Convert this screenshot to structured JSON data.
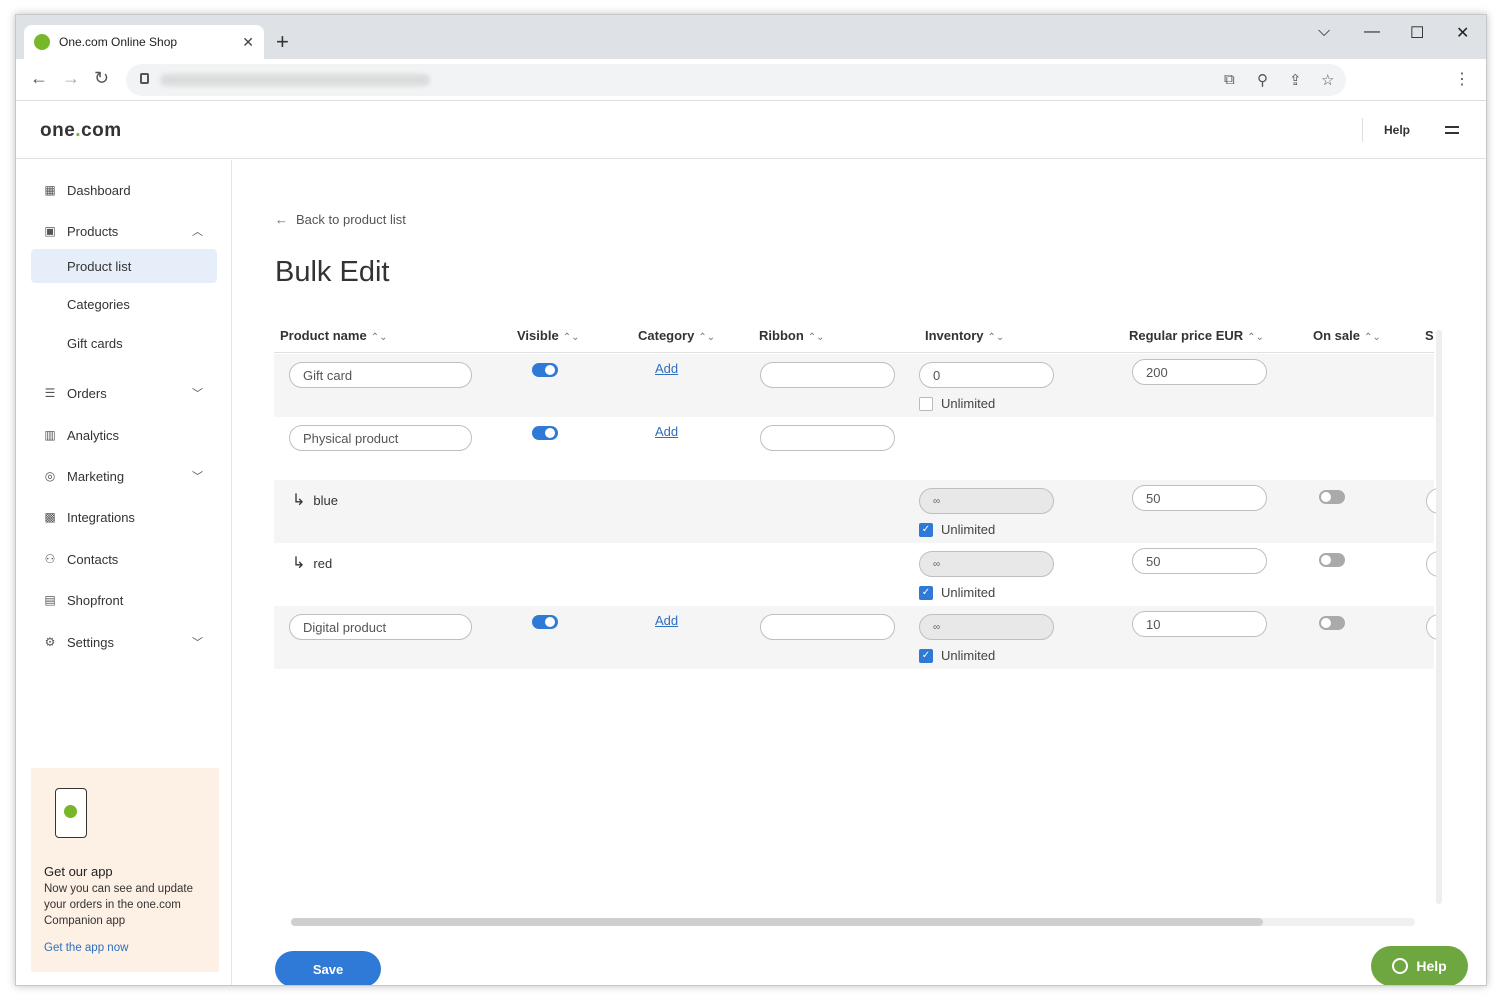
{
  "browser": {
    "tab_title": "One.com Online Shop",
    "close_glyph": "✕",
    "new_tab_glyph": "+",
    "minimize_glyph": "⌵",
    "maximize_glyph": "☐",
    "restore_glyph": "—",
    "window_close_glyph": "✕",
    "back_glyph": "←",
    "forward_glyph": "→",
    "reload_glyph": "↻",
    "translate_glyph": "⧉",
    "zoom_glyph": "⚲",
    "share_glyph": "⇪",
    "star_glyph": "☆",
    "menu_glyph": "⋮"
  },
  "header": {
    "logo_left": "one",
    "logo_dot": ".",
    "logo_right": "com",
    "help": "Help"
  },
  "sidebar": {
    "items": [
      {
        "label": "Dashboard",
        "icon": "grid-icon"
      },
      {
        "label": "Products",
        "icon": "box-icon"
      },
      {
        "label": "Orders",
        "icon": "list-icon"
      },
      {
        "label": "Analytics",
        "icon": "bar-chart-icon"
      },
      {
        "label": "Marketing",
        "icon": "target-icon"
      },
      {
        "label": "Integrations",
        "icon": "apps-icon"
      },
      {
        "label": "Contacts",
        "icon": "people-icon"
      },
      {
        "label": "Shopfront",
        "icon": "store-icon"
      },
      {
        "label": "Settings",
        "icon": "gear-icon"
      }
    ],
    "sub_items": [
      "Product list",
      "Categories",
      "Gift cards"
    ],
    "promo": {
      "title": "Get our app",
      "text": "Now you can see and update your orders in the one.com Companion app",
      "link": "Get the app now"
    }
  },
  "main": {
    "back_label": "Back to product list",
    "title": "Bulk Edit",
    "columns": [
      "Product name",
      "Visible",
      "Category",
      "Ribbon",
      "Inventory",
      "Regular price EUR",
      "On sale",
      "S"
    ],
    "sort_glyph": "⌃⌄",
    "add_label": "Add",
    "unlimited_label": "Unlimited",
    "infinity": "∞",
    "rows": [
      {
        "name": "Gift card",
        "inventory": "0",
        "price": "200"
      },
      {
        "name": "Physical product"
      },
      {
        "variant": "blue",
        "price": "50"
      },
      {
        "variant": "red",
        "price": "50"
      },
      {
        "name": "Digital product",
        "price": "10"
      }
    ],
    "save_label": "Save",
    "help_label": "Help"
  },
  "colors": {
    "accent_blue": "#2f7ad6",
    "brand_green": "#76b82a",
    "help_green": "#6ea640"
  }
}
